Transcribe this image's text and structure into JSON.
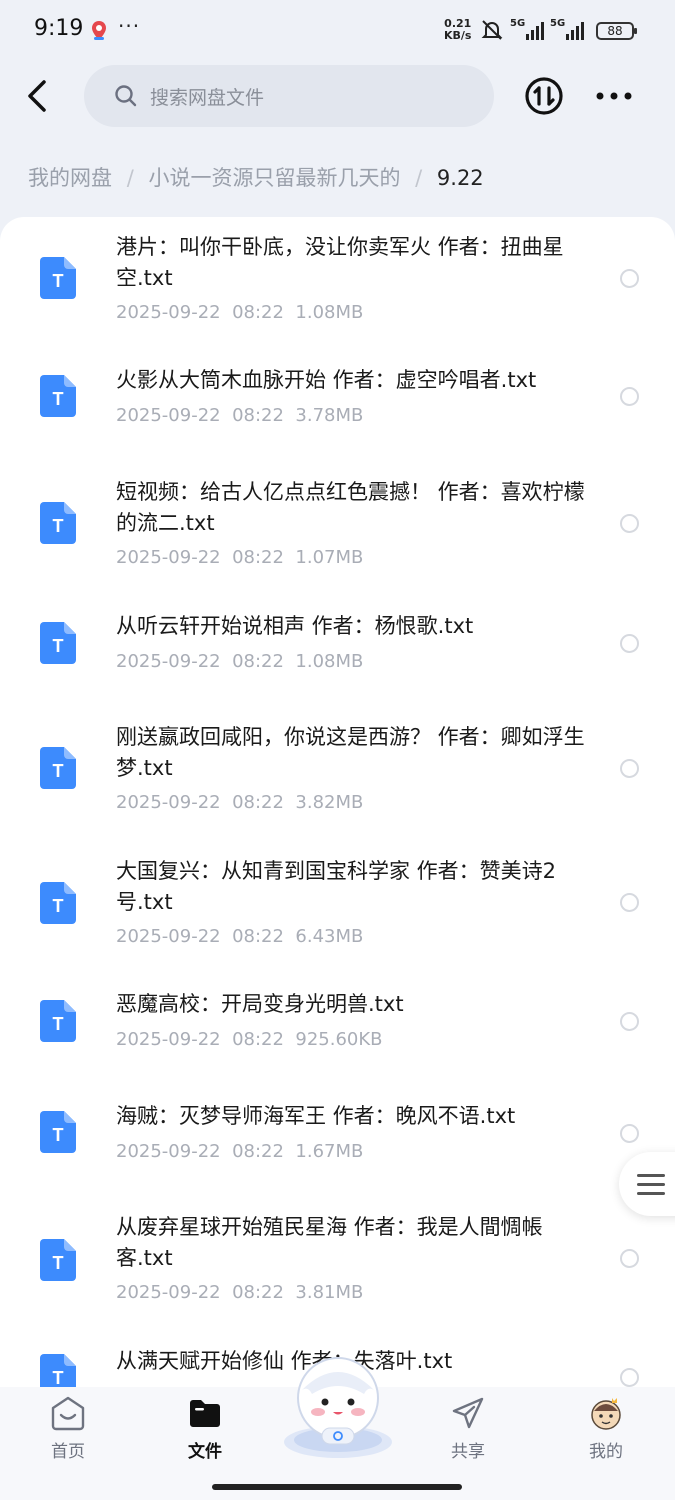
{
  "status_bar": {
    "time": "9:19",
    "dots": "···",
    "speed_value": "0.21",
    "speed_unit": "KB/s",
    "network1": "5G",
    "network2": "5G",
    "battery": "88"
  },
  "header": {
    "search_placeholder": "搜索网盘文件"
  },
  "breadcrumb": {
    "items": [
      "我的网盘",
      "小说一资源只留最新几天的"
    ],
    "separator": "/",
    "current": "9.22"
  },
  "files": [
    {
      "name": "港片：叫你干卧底，没让你卖军火 作者：扭曲星空.txt",
      "date": "2025-09-22",
      "time": "08:22",
      "size": "1.08MB"
    },
    {
      "name": "火影从大筒木血脉开始 作者：虚空吟唱者.txt",
      "date": "2025-09-22",
      "time": "08:22",
      "size": "3.78MB"
    },
    {
      "name": "短视频：给古人亿点点红色震撼！ 作者：喜欢柠檬的流二.txt",
      "date": "2025-09-22",
      "time": "08:22",
      "size": "1.07MB"
    },
    {
      "name": "从听云轩开始说相声 作者：杨恨歌.txt",
      "date": "2025-09-22",
      "time": "08:22",
      "size": "1.08MB"
    },
    {
      "name": "刚送嬴政回咸阳，你说这是西游？ 作者：卿如浮生梦.txt",
      "date": "2025-09-22",
      "time": "08:22",
      "size": "3.82MB"
    },
    {
      "name": "大国复兴：从知青到国宝科学家 作者：赞美诗2号.txt",
      "date": "2025-09-22",
      "time": "08:22",
      "size": "6.43MB"
    },
    {
      "name": "恶魔高校：开局变身光明兽.txt",
      "date": "2025-09-22",
      "time": "08:22",
      "size": "925.60KB"
    },
    {
      "name": "海贼：灭梦导师海军王 作者：晚风不语.txt",
      "date": "2025-09-22",
      "time": "08:22",
      "size": "1.67MB"
    },
    {
      "name": "从废弃星球开始殖民星海 作者：我是人間惆帳客.txt",
      "date": "2025-09-22",
      "time": "08:22",
      "size": "3.81MB"
    },
    {
      "name": "从满天赋开始修仙 作者：失落叶.txt",
      "date": "",
      "time": "",
      "size": ""
    }
  ],
  "file_icon_letter": "T",
  "bottom_nav": {
    "home": "首页",
    "files": "文件",
    "share": "共享",
    "mine": "我的"
  },
  "colors": {
    "accent_blue": "#3d8bfd",
    "text_primary": "#1a1a1a",
    "text_secondary": "#a9adb6"
  }
}
